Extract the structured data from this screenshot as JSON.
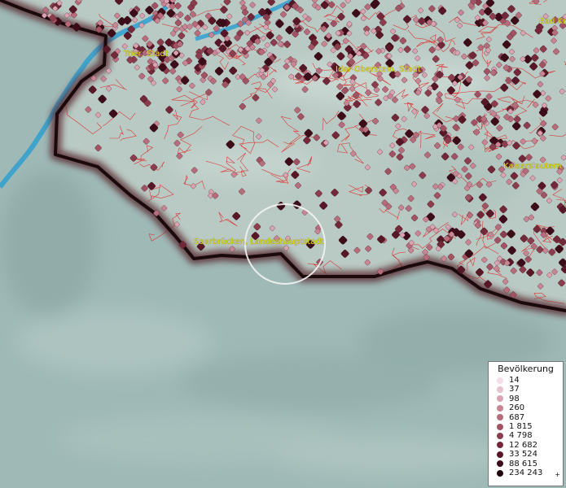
{
  "map": {
    "cities": [
      {
        "name": "Trier, Stadt"
      },
      {
        "name": "Idar-Oberstein, Stadt"
      },
      {
        "name": "Bad Kr"
      },
      {
        "name": "Kaiserslautern"
      },
      {
        "name": "Saarbrücken, Landeshauptstadt"
      }
    ],
    "colors": {
      "background": "#9fb9b6",
      "settled_area": "#b9c9c3",
      "border_line": "#1a0a0c",
      "border_halo": "#5a2a33",
      "river": "#2f9fd0",
      "municipality_lines": "#e02020",
      "label_text": "#e8e000"
    }
  },
  "legend": {
    "title": "Bevölkerung",
    "plus": "+",
    "items": [
      {
        "label": "14",
        "color": "#f3dde7"
      },
      {
        "label": "37",
        "color": "#e7c3cf"
      },
      {
        "label": "98",
        "color": "#d9a3b1"
      },
      {
        "label": "260",
        "color": "#c98594"
      },
      {
        "label": "687",
        "color": "#b76c7b"
      },
      {
        "label": "1 815",
        "color": "#a25363"
      },
      {
        "label": "4 798",
        "color": "#8b3d4d"
      },
      {
        "label": "12 682",
        "color": "#722838"
      },
      {
        "label": "33 524",
        "color": "#571727"
      },
      {
        "label": "88 615",
        "color": "#3c0c18"
      },
      {
        "label": "234 243",
        "color": "#22040c"
      }
    ]
  }
}
